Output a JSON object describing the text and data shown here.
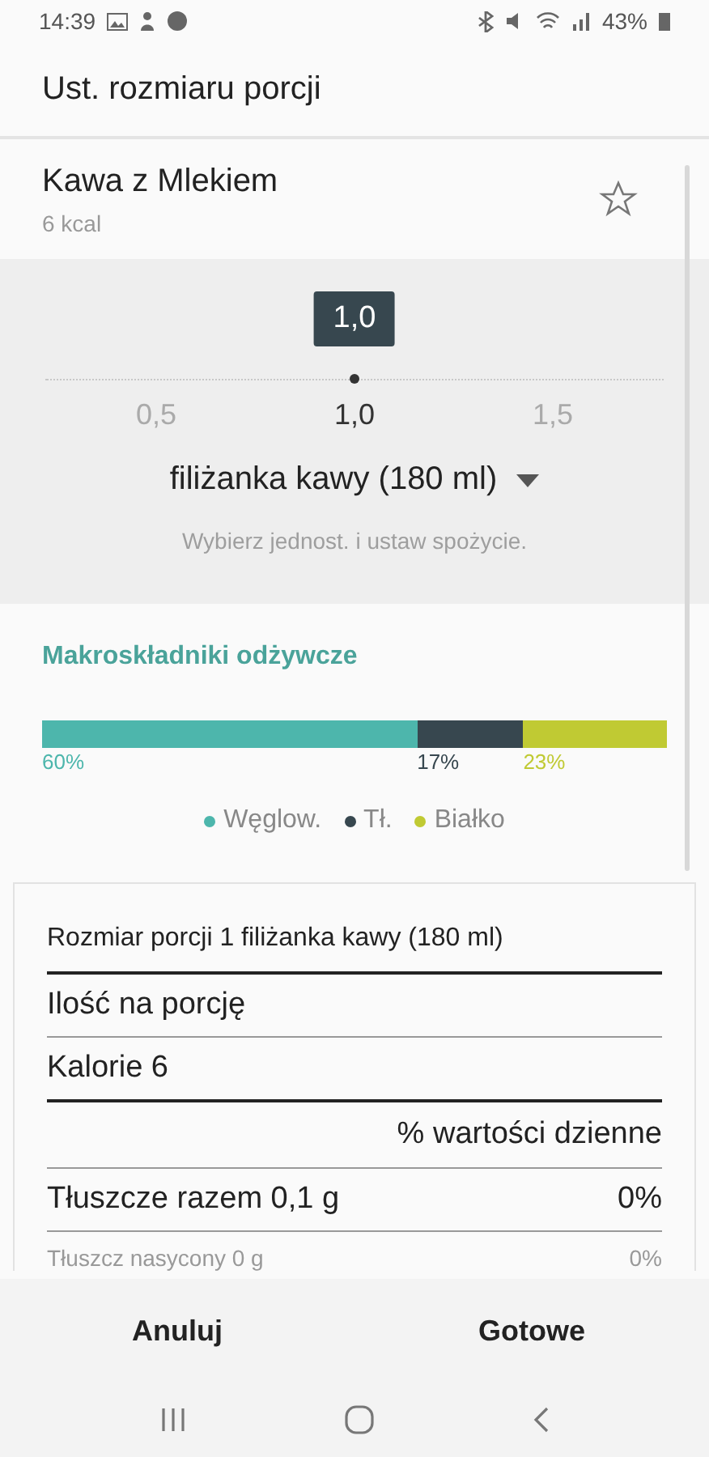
{
  "status_bar": {
    "time": "14:39",
    "battery": "43%"
  },
  "title": "Ust. rozmiaru porcji",
  "food": {
    "name": "Kawa z Mlekiem",
    "calories": "6 kcal",
    "favorite": false
  },
  "slider": {
    "value": "1,0",
    "level": 0.5,
    "labels": [
      {
        "text": "0,5",
        "selected": false
      },
      {
        "text": "1,0",
        "selected": true
      },
      {
        "text": "1,5",
        "selected": false
      }
    ]
  },
  "unit": {
    "label": "filiżanka kawy (180 ml)",
    "hint": "Wybierz jednost. i ustaw spożycie."
  },
  "macros": {
    "title": "Makroskładniki odżywcze",
    "items": [
      {
        "name": "Węglow.",
        "percent": "60%",
        "color": "#4db6ac"
      },
      {
        "name": "Tł.",
        "percent": "17%",
        "color": "#37474f"
      },
      {
        "name": "Białko",
        "percent": "23%",
        "color": "#c0ca33"
      }
    ]
  },
  "nutrition": [
    {
      "kind": "header",
      "label": "Rozmiar porcji 1 filiżanka kawy (180 ml)"
    },
    {
      "kind": "main",
      "label": "Ilość na porcję"
    },
    {
      "kind": "total",
      "label": "Kalorie 6"
    },
    {
      "kind": "daily",
      "label": "% wartości dzienne"
    },
    {
      "kind": "main",
      "label": "Tłuszcze razem 0,1 g",
      "value": "0%"
    },
    {
      "kind": "sub",
      "label": "Tłuszcz nasycony 0 g",
      "value": "0%"
    }
  ],
  "buttons": [
    {
      "label": "Anuluj"
    },
    {
      "label": "Gotowe"
    }
  ]
}
